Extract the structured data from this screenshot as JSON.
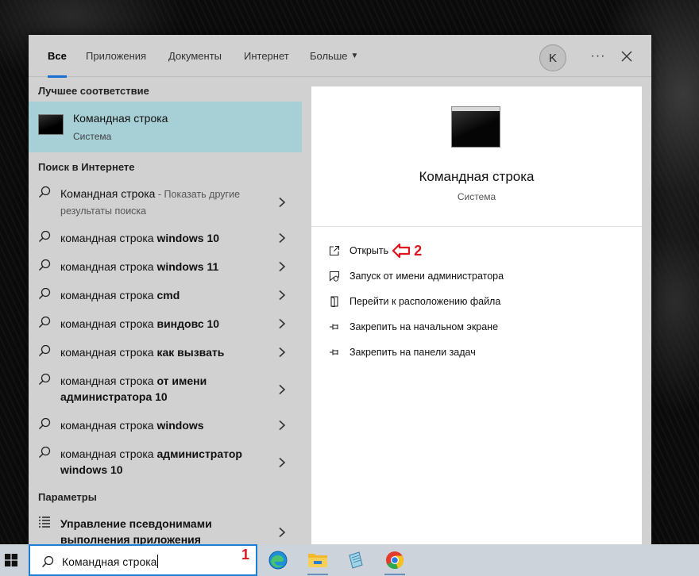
{
  "tabs": [
    {
      "label": "Все",
      "active": true
    },
    {
      "label": "Приложения"
    },
    {
      "label": "Документы"
    },
    {
      "label": "Интернет"
    },
    {
      "label": "Больше"
    }
  ],
  "account": {
    "initial": "K"
  },
  "more_menu": {
    "glyph": "···"
  },
  "sections": {
    "best_match": "Лучшее соответствие",
    "web_search": "Поиск в Интернете",
    "settings": "Параметры"
  },
  "best_match_item": {
    "title": "Командная строка",
    "subtitle": "Система"
  },
  "web_results": [
    {
      "prefix": "Командная строка",
      "bold": "",
      "hint": " - Показать другие результаты поиска"
    },
    {
      "prefix": "командная строка ",
      "bold": "windows 10",
      "hint": ""
    },
    {
      "prefix": "командная строка ",
      "bold": "windows 11",
      "hint": ""
    },
    {
      "prefix": "командная строка ",
      "bold": "cmd",
      "hint": ""
    },
    {
      "prefix": "командная строка ",
      "bold": "виндовс 10",
      "hint": ""
    },
    {
      "prefix": "командная строка ",
      "bold": "как вызвать",
      "hint": ""
    },
    {
      "prefix": "командная строка ",
      "bold": "от имени администратора 10",
      "hint": ""
    },
    {
      "prefix": "командная строка ",
      "bold": "windows",
      "hint": ""
    },
    {
      "prefix": "командная строка ",
      "bold": "администратор windows 10",
      "hint": ""
    }
  ],
  "settings_items": [
    {
      "label": "Управление псевдонимами выполнения приложения"
    }
  ],
  "preview": {
    "title": "Командная строка",
    "subtitle": "Система",
    "actions": [
      {
        "label": "Открыть",
        "icon": "open-icon"
      },
      {
        "label": "Запуск от имени администратора",
        "icon": "shield-icon"
      },
      {
        "label": "Перейти к расположению файла",
        "icon": "file-location-icon"
      },
      {
        "label": "Закрепить на начальном экране",
        "icon": "pin-icon"
      },
      {
        "label": "Закрепить на панели задач",
        "icon": "pin-icon"
      }
    ]
  },
  "annotations": {
    "step1": "1",
    "step2": "2"
  },
  "search": {
    "value": "Командная строка"
  },
  "taskbar_apps": [
    "edge-icon",
    "file-explorer-icon",
    "notepad-icon",
    "chrome-icon"
  ],
  "colors": {
    "accent": "#1a6fd1",
    "highlight": "#a6cfd6",
    "annotation": "#e0141e"
  }
}
